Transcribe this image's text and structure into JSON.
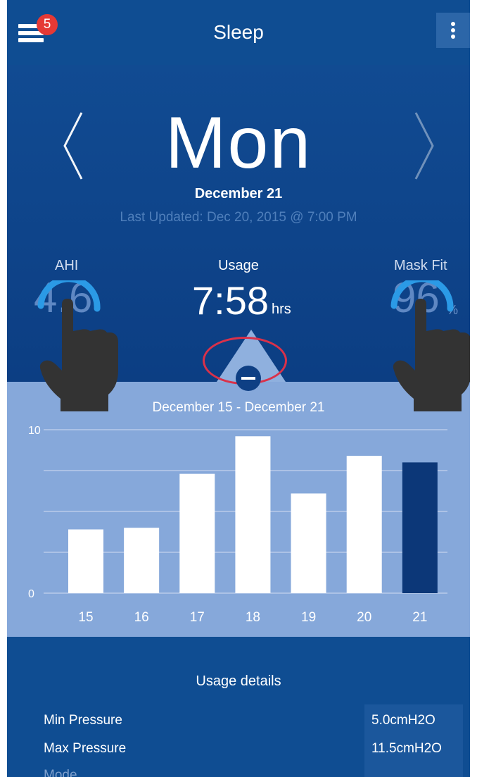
{
  "header": {
    "title": "Sleep",
    "notification_count": "5",
    "menu_icon": "hamburger-menu-icon",
    "more_icon": "vertical-ellipsis-icon"
  },
  "day_nav": {
    "prev_glyph": "⟨",
    "day": "Mon",
    "next_glyph": "⟩",
    "date": "December 21",
    "last_updated": "Last Updated: Dec 20, 2015 @ 7:00 PM"
  },
  "metrics": {
    "ahi": {
      "label": "AHI",
      "value": "4.6"
    },
    "usage": {
      "label": "Usage",
      "value": "7:58",
      "unit": "hrs"
    },
    "mask_fit": {
      "label": "Mask Fit",
      "value": "96",
      "unit": "%"
    }
  },
  "chart_data": {
    "type": "bar",
    "title": "December 15 - December 21",
    "categories": [
      "15",
      "16",
      "17",
      "18",
      "19",
      "20",
      "21"
    ],
    "values": [
      3.9,
      4.0,
      7.3,
      9.6,
      6.1,
      8.4,
      8.0
    ],
    "highlight_index": 6,
    "ylim": [
      0,
      10
    ],
    "yticks": [
      0,
      10
    ],
    "grid": true,
    "colors": {
      "bar": "#ffffff",
      "highlight": "#0c3778",
      "grid": "#b8cbea",
      "panel": "#86a8da"
    }
  },
  "details": {
    "title": "Usage details",
    "rows": [
      {
        "label": "Min Pressure",
        "value": "5.0cmH2O"
      },
      {
        "label": "Max Pressure",
        "value": "11.5cmH2O"
      },
      {
        "label": "Mode",
        "value": ""
      }
    ]
  },
  "colors": {
    "header_bg": "#0f4d92",
    "badge": "#e53935",
    "gesture_ring": "#2b9ae6",
    "collapse_ring": "#d9314a"
  }
}
